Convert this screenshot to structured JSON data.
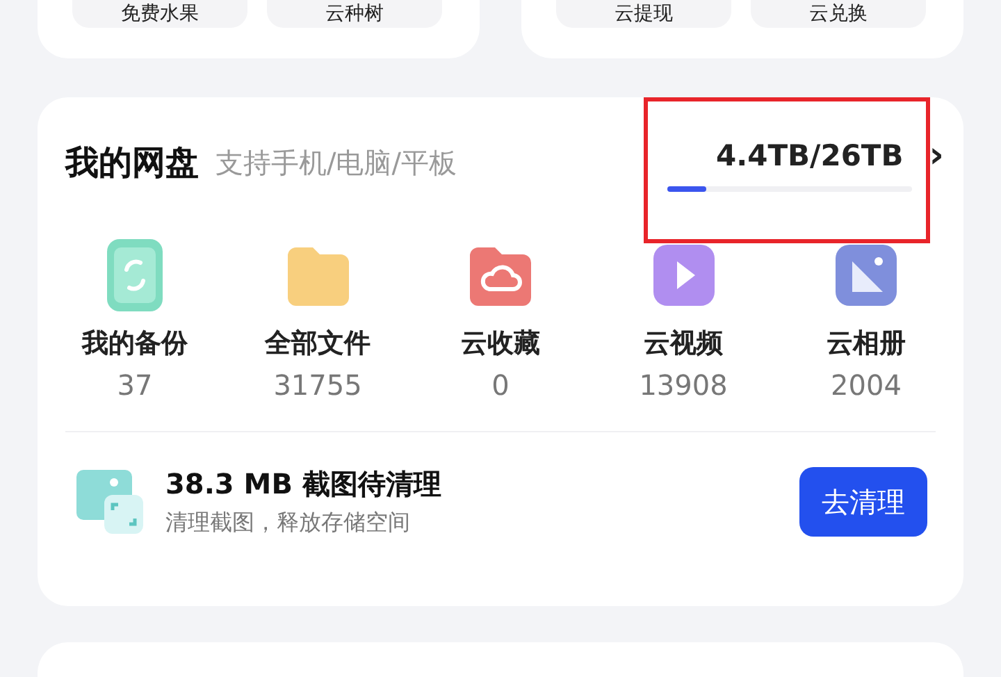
{
  "top_cards": [
    {
      "buttons": [
        "免费水果",
        "云种树"
      ]
    },
    {
      "buttons": [
        "云提现",
        "云兑换"
      ]
    }
  ],
  "disk": {
    "title": "我的网盘",
    "subtitle": "支持手机/电脑/平板",
    "usage": "4.4TB/26TB",
    "level": 0.16,
    "chevron": "›",
    "highlighted": true,
    "items": [
      {
        "kind": "backup",
        "label": "我的备份",
        "count": "37"
      },
      {
        "kind": "folder",
        "label": "全部文件",
        "count": "31755"
      },
      {
        "kind": "cloud",
        "label": "云收藏",
        "count": "0"
      },
      {
        "kind": "video",
        "label": "云视频",
        "count": "13908"
      },
      {
        "kind": "album",
        "label": "云相册",
        "count": "2004"
      }
    ],
    "cleanup": {
      "title": "38.3 MB 截图待清理",
      "description": "清理截图，释放存储空间",
      "button": "去清理"
    }
  }
}
